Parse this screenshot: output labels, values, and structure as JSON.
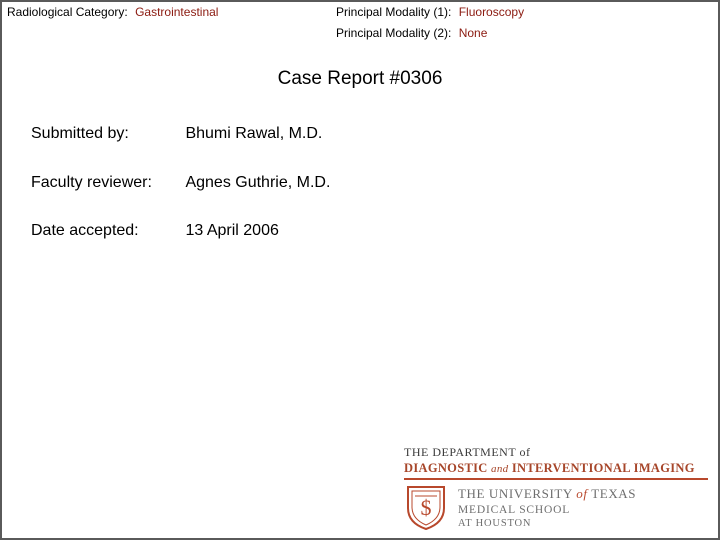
{
  "header": {
    "category_label": "Radiological Category:",
    "category_value": "Gastrointestinal",
    "modality1_label": "Principal Modality (1):",
    "modality1_value": "Fluoroscopy",
    "modality2_label": "Principal Modality (2):",
    "modality2_value": "None"
  },
  "title": "Case Report #0306",
  "info": [
    {
      "label": "Submitted by:",
      "value": "Bhumi Rawal, M.D."
    },
    {
      "label": "Faculty reviewer:",
      "value": "Agnes Guthrie, M.D."
    },
    {
      "label": "Date accepted:",
      "value": "13 April 2006"
    }
  ],
  "logo": {
    "dept_line1": "THE DEPARTMENT of",
    "dept_line2_a": "DIAGNOSTIC",
    "dept_line2_and": "and",
    "dept_line2_b": "INTERVENTIONAL IMAGING",
    "university_a": "THE UNIVERSITY",
    "university_of": "of",
    "university_b": "TEXAS",
    "medical_school": "MEDICAL SCHOOL",
    "houston": "AT HOUSTON"
  },
  "colors": {
    "accent": "#8b1a10",
    "logo_accent": "#b8482c",
    "border": "#5a5a5a"
  }
}
